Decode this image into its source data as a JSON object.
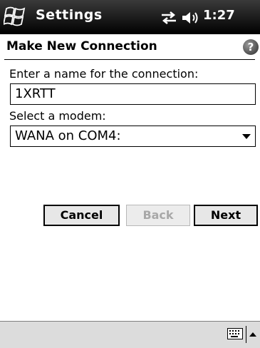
{
  "titlebar": {
    "app_title": "Settings",
    "time": "1:27"
  },
  "header": {
    "page_title": "Make New Connection"
  },
  "form": {
    "name_label": "Enter a name for the connection:",
    "name_value": "1XRTT",
    "modem_label": "Select a modem:",
    "modem_value": "WANA on COM4:"
  },
  "buttons": {
    "cancel": "Cancel",
    "back": "Back",
    "next": "Next"
  },
  "icons": {
    "start": "windows-flag-icon",
    "connectivity": "connectivity-icon",
    "speaker": "speaker-icon",
    "help": "help-icon",
    "keyboard": "keyboard-icon",
    "sip_arrow": "chevron-up-icon"
  }
}
